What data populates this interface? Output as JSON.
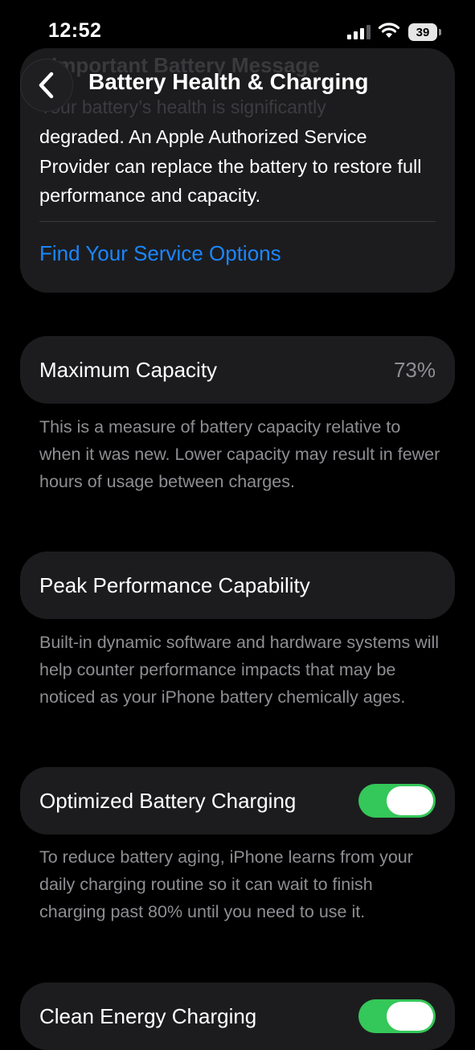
{
  "status_bar": {
    "time": "12:52",
    "battery_level": "39"
  },
  "nav": {
    "title": "Battery Health & Charging",
    "faded_heading": "Important Battery Message"
  },
  "message_card": {
    "faded_line": "Your battery’s health is significantly",
    "body": "degraded. An Apple Authorized Service Provider can replace the battery to restore full performance and capacity.",
    "link": "Find Your Service Options"
  },
  "rows": {
    "max_capacity": {
      "label": "Maximum Capacity",
      "value": "73%"
    },
    "peak_performance": {
      "label": "Peak Performance Capability"
    },
    "optimized_charging": {
      "label": "Optimized Battery Charging",
      "on": true
    },
    "clean_energy": {
      "label": "Clean Energy Charging",
      "on": true
    }
  },
  "footnotes": {
    "max_capacity": "This is a measure of battery capacity relative to when it was new. Lower capacity may result in fewer hours of usage between charges.",
    "peak_performance": "Built-in dynamic software and hardware systems will help counter performance impacts that may be noticed as your iPhone battery chemically ages.",
    "optimized_charging": "To reduce battery aging, iPhone learns from your daily charging routine so it can wait to finish charging past 80% until you need to use it."
  },
  "colors": {
    "accent": "#1a86ff",
    "toggle_on": "#34c759",
    "card": "#1c1c1e"
  },
  "icons": [
    "signal-icon",
    "wifi-icon",
    "battery-icon",
    "chevron-left-icon"
  ]
}
